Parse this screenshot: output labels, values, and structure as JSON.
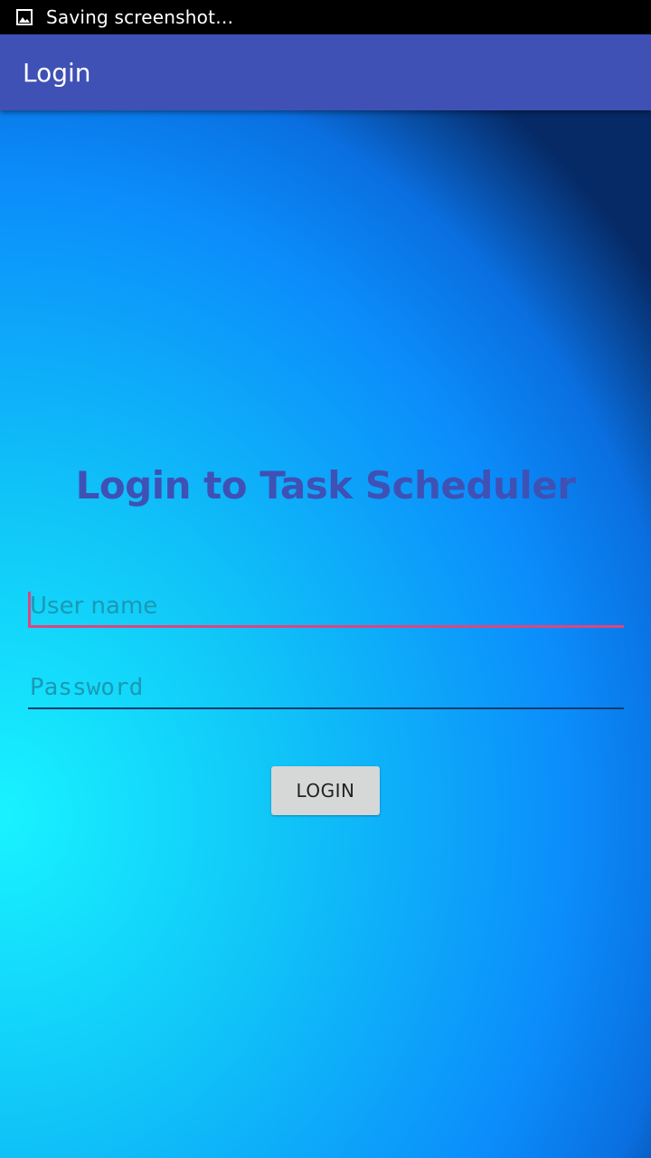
{
  "status_bar": {
    "icon": "image-icon",
    "text": "Saving screenshot…"
  },
  "app_bar": {
    "title": "Login"
  },
  "main": {
    "heading": "Login to Task Scheduler",
    "username": {
      "value": "",
      "placeholder": "User name"
    },
    "password": {
      "value": "",
      "placeholder": "Password"
    },
    "login_label": "LOGIN"
  },
  "colors": {
    "app_bar": "#3f51b5",
    "heading": "#3f51b5",
    "focus_accent": "#e0447f",
    "button": "#d6d7d7"
  }
}
